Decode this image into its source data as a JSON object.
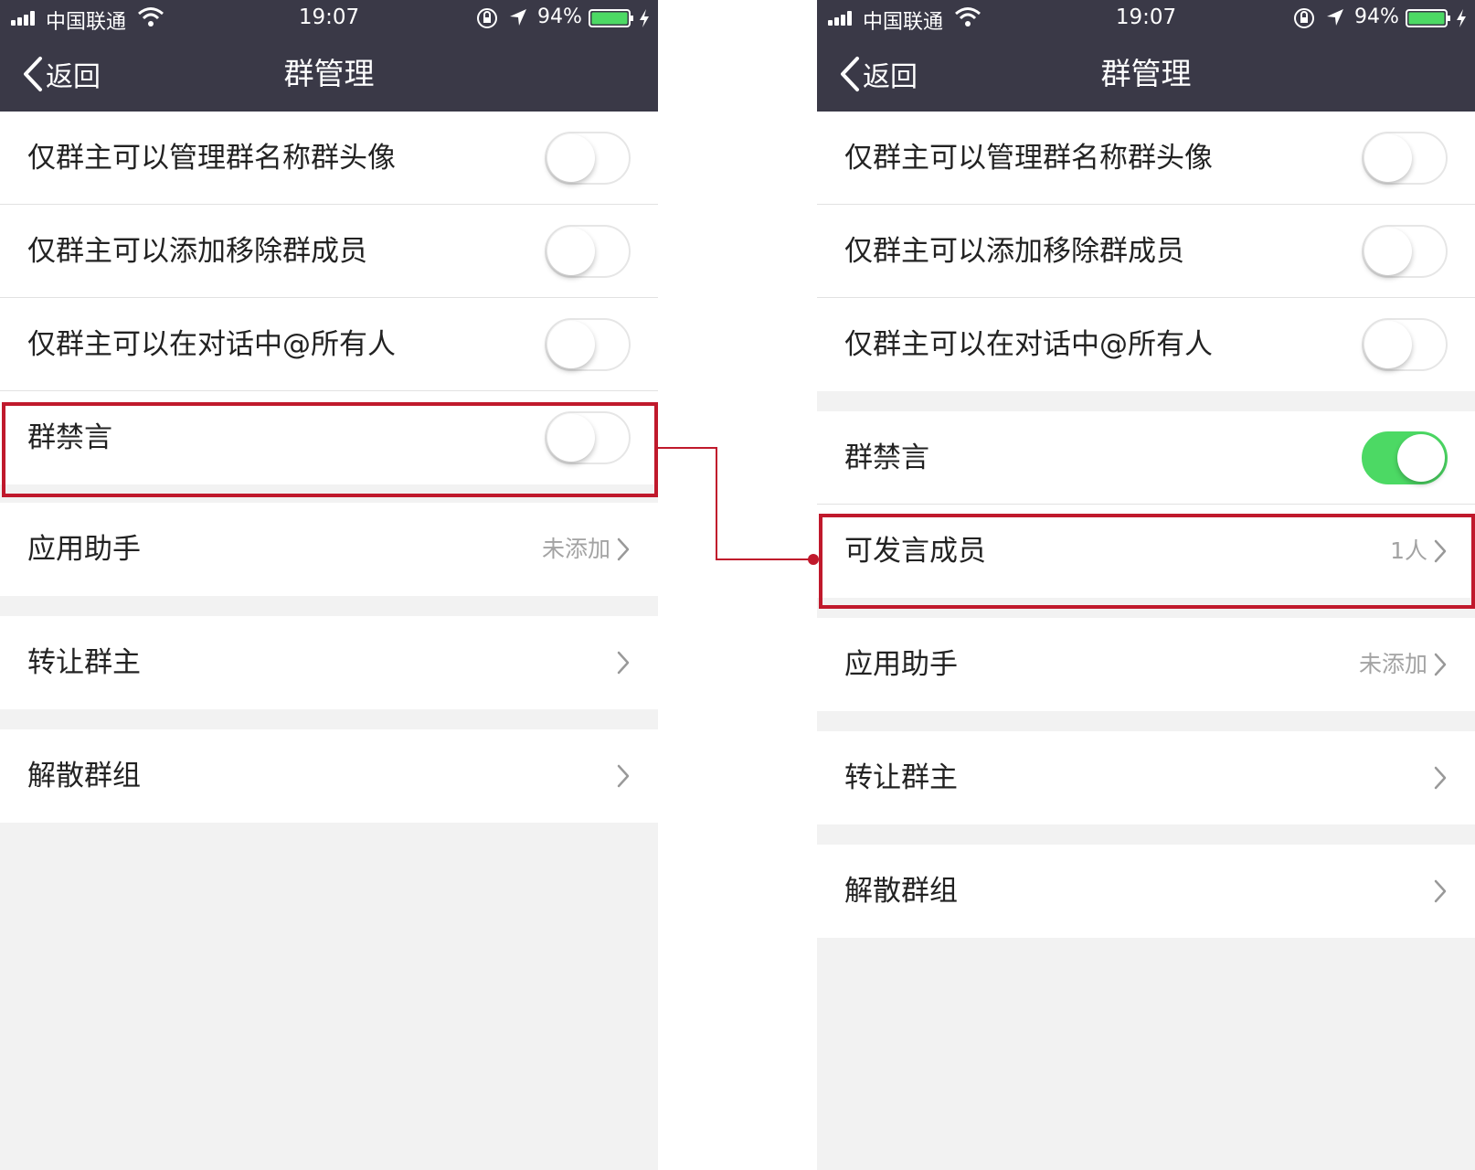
{
  "status_bar": {
    "carrier": "中国联通",
    "time": "19:07",
    "battery": "94%"
  },
  "nav": {
    "back_label": "返回",
    "title": "群管理"
  },
  "left_screen": {
    "toggles": [
      {
        "label": "仅群主可以管理群名称群头像",
        "on": false
      },
      {
        "label": "仅群主可以添加移除群成员",
        "on": false
      },
      {
        "label": "仅群主可以在对话中@所有人",
        "on": false
      },
      {
        "label": "群禁言",
        "on": false
      }
    ],
    "app_helper": {
      "label": "应用助手",
      "value": "未添加"
    },
    "transfer_owner": {
      "label": "转让群主"
    },
    "dissolve_group": {
      "label": "解散群组"
    }
  },
  "right_screen": {
    "toggles": [
      {
        "label": "仅群主可以管理群名称群头像",
        "on": false
      },
      {
        "label": "仅群主可以添加移除群成员",
        "on": false
      },
      {
        "label": "仅群主可以在对话中@所有人",
        "on": false
      }
    ],
    "mute_all": {
      "label": "群禁言",
      "on": true
    },
    "allowed_speakers": {
      "label": "可发言成员",
      "value": "1人"
    },
    "app_helper": {
      "label": "应用助手",
      "value": "未添加"
    },
    "transfer_owner": {
      "label": "转让群主"
    },
    "dissolve_group": {
      "label": "解散群组"
    }
  },
  "colors": {
    "header_bg": "#3a3947",
    "toggle_on": "#4cd964",
    "highlight": "#c0192c",
    "page_bg": "#f2f2f2"
  }
}
